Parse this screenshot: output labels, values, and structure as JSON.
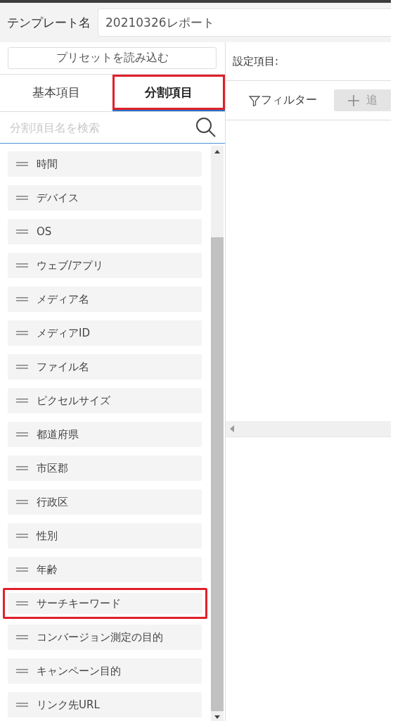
{
  "template": {
    "label": "テンプレート名",
    "value": "20210326レポート"
  },
  "preset_button": "プリセットを読み込む",
  "tabs": [
    {
      "label": "基本項目",
      "selected": false,
      "highlighted": false
    },
    {
      "label": "分割項目",
      "selected": true,
      "highlighted": true
    }
  ],
  "search": {
    "placeholder": "分割項目名を検索"
  },
  "items": [
    {
      "label": "時間",
      "highlighted": false
    },
    {
      "label": "デバイス",
      "highlighted": false
    },
    {
      "label": "OS",
      "highlighted": false
    },
    {
      "label": "ウェブ/アプリ",
      "highlighted": false
    },
    {
      "label": "メディア名",
      "highlighted": false
    },
    {
      "label": "メディアID",
      "highlighted": false
    },
    {
      "label": "ファイル名",
      "highlighted": false
    },
    {
      "label": "ピクセルサイズ",
      "highlighted": false
    },
    {
      "label": "都道府県",
      "highlighted": false
    },
    {
      "label": "市区郡",
      "highlighted": false
    },
    {
      "label": "行政区",
      "highlighted": false
    },
    {
      "label": "性別",
      "highlighted": false
    },
    {
      "label": "年齢",
      "highlighted": false
    },
    {
      "label": "サーチキーワード",
      "highlighted": true
    },
    {
      "label": "コンバージョン測定の目的",
      "highlighted": false
    },
    {
      "label": "キャンペーン目的",
      "highlighted": false
    },
    {
      "label": "リンク先URL",
      "highlighted": false
    }
  ],
  "settings": {
    "label": "設定項目:"
  },
  "filter_button": "フィルター",
  "add_button": "追"
}
